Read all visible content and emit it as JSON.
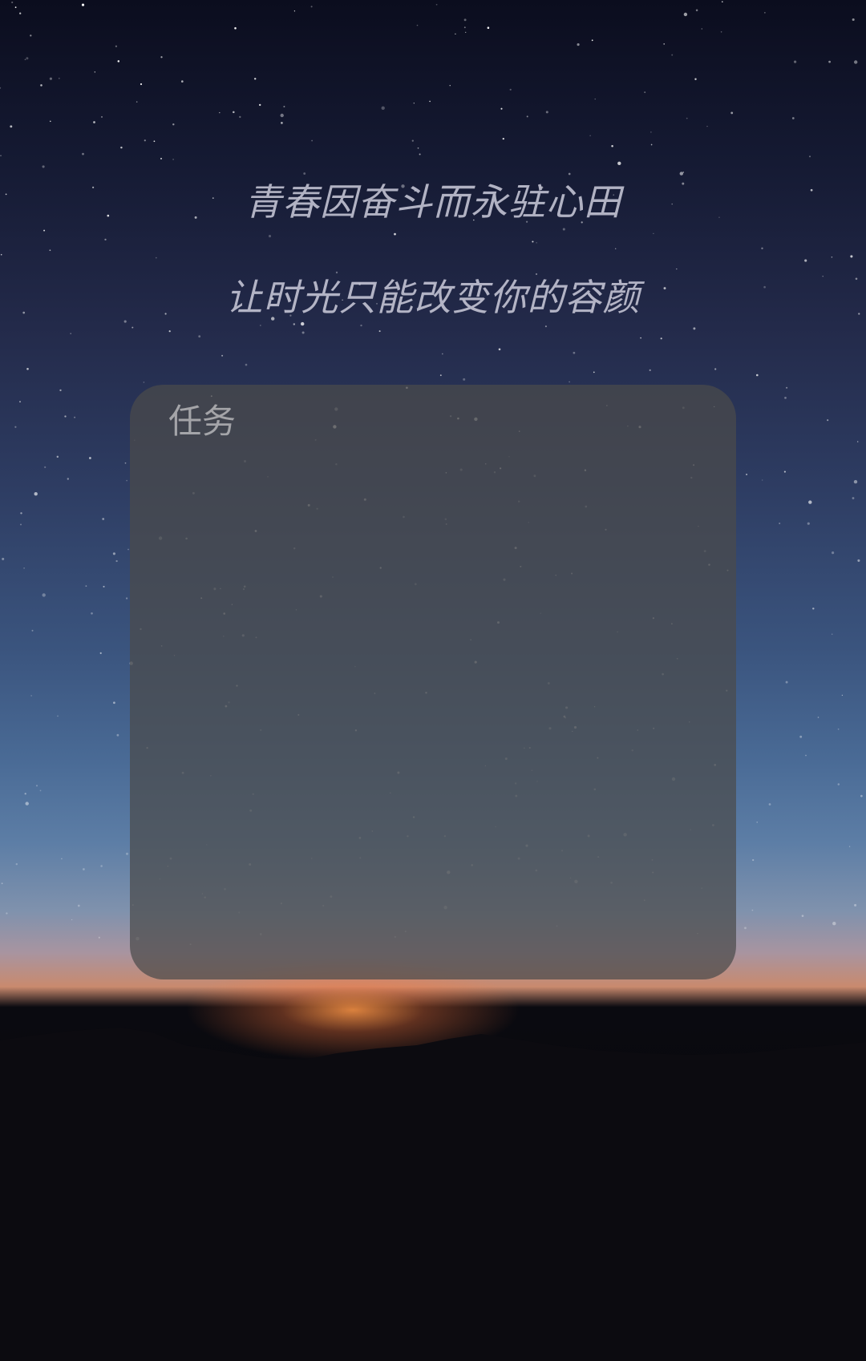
{
  "quotes": {
    "line1": "青春因奋斗而永驻心田",
    "line2": "让时光只能改变你的容颜"
  },
  "task_card": {
    "label": "任务"
  },
  "colors": {
    "card_background": "#4b4b4b",
    "quote_text": "#cdcddc",
    "label_text": "#afafb2"
  }
}
